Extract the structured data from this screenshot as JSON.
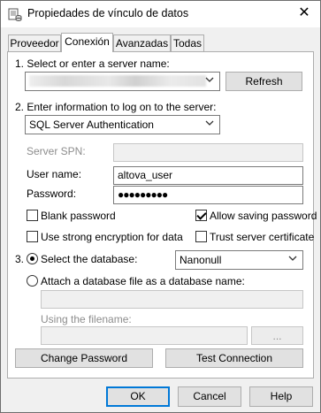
{
  "window": {
    "title": "Propiedades de vínculo de datos",
    "close_glyph": "✕"
  },
  "tabs": [
    {
      "label": "Proveedor",
      "active": false
    },
    {
      "label": "Conexión",
      "active": true
    },
    {
      "label": "Avanzadas",
      "active": false
    },
    {
      "label": "Todas",
      "active": false
    }
  ],
  "step1": {
    "label": "1. Select or enter a server name:",
    "server_value": "",
    "refresh_label": "Refresh"
  },
  "step2": {
    "label": "2. Enter information to log on to the server:",
    "auth_value": "SQL Server Authentication",
    "server_spn_label": "Server SPN:",
    "server_spn_value": "",
    "username_label": "User name:",
    "username_value": "altova_user",
    "password_label": "Password:",
    "password_value": "●●●●●●●●●",
    "blank_password_label": "Blank password",
    "blank_password_checked": false,
    "allow_saving_label": "Allow saving password",
    "allow_saving_checked": true,
    "strong_encryption_label": "Use strong encryption for data",
    "strong_encryption_checked": false,
    "trust_cert_label": "Trust server certificate",
    "trust_cert_checked": false
  },
  "step3": {
    "number": "3.",
    "select_db_label": "Select the database:",
    "select_db_selected": true,
    "database_value": "Nanonull",
    "attach_label": "Attach a database file as a database name:",
    "attach_selected": false,
    "attach_value": "",
    "filename_label": "Using the filename:",
    "filename_value": "",
    "browse_label": "..."
  },
  "panel_buttons": {
    "change_password": "Change Password",
    "test_connection": "Test Connection"
  },
  "footer": {
    "ok": "OK",
    "cancel": "Cancel",
    "help": "Help"
  },
  "colors": {
    "accent": "#0078d7"
  },
  "icons": {
    "window": "data-link-icon",
    "dropdown": "chevron-down-icon"
  }
}
